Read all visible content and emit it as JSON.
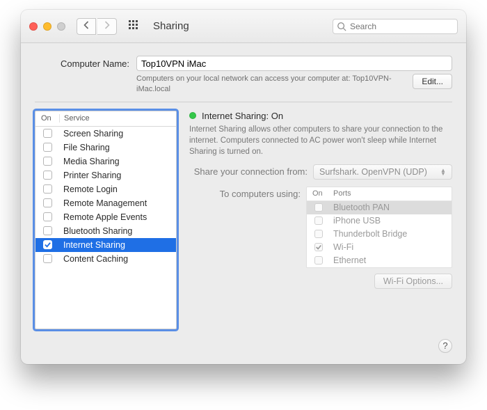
{
  "toolbar": {
    "title": "Sharing",
    "search_placeholder": "Search"
  },
  "computer_name": {
    "label": "Computer Name:",
    "value": "Top10VPN iMac",
    "description": "Computers on your local network can access your computer at: Top10VPN-iMac.local",
    "edit_label": "Edit..."
  },
  "services": {
    "headers": {
      "on": "On",
      "service": "Service"
    },
    "items": [
      {
        "label": "Screen Sharing",
        "on": false
      },
      {
        "label": "File Sharing",
        "on": false
      },
      {
        "label": "Media Sharing",
        "on": false
      },
      {
        "label": "Printer Sharing",
        "on": false
      },
      {
        "label": "Remote Login",
        "on": false
      },
      {
        "label": "Remote Management",
        "on": false
      },
      {
        "label": "Remote Apple Events",
        "on": false
      },
      {
        "label": "Bluetooth Sharing",
        "on": false
      },
      {
        "label": "Internet Sharing",
        "on": true
      },
      {
        "label": "Content Caching",
        "on": false
      }
    ],
    "selected_index": 8
  },
  "detail": {
    "status_title": "Internet Sharing: On",
    "status_color": "#34c749",
    "description": "Internet Sharing allows other computers to share your connection to the internet. Computers connected to AC power won't sleep while Internet Sharing is turned on.",
    "share_from_label": "Share your connection from:",
    "share_from_value": "Surfshark. OpenVPN (UDP)",
    "to_label": "To computers using:",
    "ports_headers": {
      "on": "On",
      "ports": "Ports"
    },
    "ports": [
      {
        "label": "Bluetooth PAN",
        "on": false
      },
      {
        "label": "iPhone USB",
        "on": false
      },
      {
        "label": "Thunderbolt Bridge",
        "on": false
      },
      {
        "label": "Wi-Fi",
        "on": true
      },
      {
        "label": "Ethernet",
        "on": false
      }
    ],
    "ports_selected_index": 0,
    "wifi_options_label": "Wi-Fi Options..."
  },
  "help_label": "?"
}
